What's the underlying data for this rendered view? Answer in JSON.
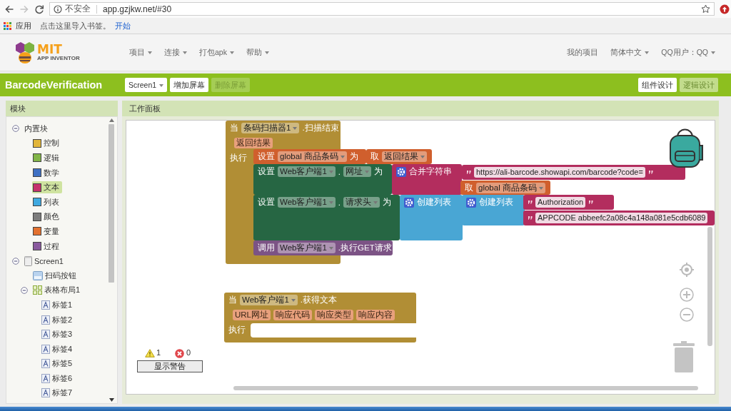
{
  "browser": {
    "security_label": "不安全",
    "url": "app.gzjkw.net/#30"
  },
  "bookmarks_bar": {
    "apps_label": "应用",
    "hint": "点击这里导入书签。",
    "link": "开始"
  },
  "app_header": {
    "logo": {
      "title": "MIT",
      "subtitle": "APP INVENTOR"
    },
    "menu": [
      {
        "label": "项目",
        "dropdown": true
      },
      {
        "label": "连接",
        "dropdown": true
      },
      {
        "label": "打包apk",
        "dropdown": true
      },
      {
        "label": "帮助",
        "dropdown": true
      }
    ],
    "user_menu": [
      {
        "label": "我的项目",
        "dropdown": false
      },
      {
        "label": "简体中文",
        "dropdown": true
      },
      {
        "label": "QQ用户：QQ",
        "dropdown": true
      }
    ]
  },
  "project_bar": {
    "title": "BarcodeVerification",
    "screen_select": "Screen1",
    "screen_buttons": [
      {
        "label": "增加屏幕",
        "disabled": false
      },
      {
        "label": "删除屏幕",
        "disabled": true
      }
    ],
    "view_buttons": [
      {
        "label": "组件设计",
        "selected": false
      },
      {
        "label": "逻辑设计",
        "selected": true
      }
    ]
  },
  "blocks_panel": {
    "title": "模块",
    "tree": [
      {
        "label": "内置块",
        "kind": "folder",
        "expanded": true,
        "selected": false,
        "children": [
          {
            "label": "控制",
            "kind": "category",
            "color": "#e1b53a",
            "selected": false
          },
          {
            "label": "逻辑",
            "kind": "category",
            "color": "#82b548",
            "selected": false
          },
          {
            "label": "数学",
            "kind": "category",
            "color": "#3f71c4",
            "selected": false
          },
          {
            "label": "文本",
            "kind": "category",
            "color": "#c5326c",
            "selected": true
          },
          {
            "label": "列表",
            "kind": "category",
            "color": "#3fa9e0",
            "selected": false
          },
          {
            "label": "颜色",
            "kind": "category",
            "color": "#7d7d7d",
            "selected": false
          },
          {
            "label": "变量",
            "kind": "category",
            "color": "#e3712f",
            "selected": false
          },
          {
            "label": "过程",
            "kind": "category",
            "color": "#8a5a9e",
            "selected": false
          }
        ]
      },
      {
        "label": "Screen1",
        "kind": "screen",
        "expanded": true,
        "selected": false,
        "children": [
          {
            "label": "扫码按钮",
            "kind": "button",
            "selected": false
          },
          {
            "label": "表格布局1",
            "kind": "table",
            "expanded": true,
            "selected": false,
            "children": [
              {
                "label": "标签1",
                "kind": "label",
                "selected": false
              },
              {
                "label": "标签2",
                "kind": "label",
                "selected": false
              },
              {
                "label": "标签3",
                "kind": "label",
                "selected": false
              },
              {
                "label": "标签4",
                "kind": "label",
                "selected": false
              },
              {
                "label": "标签5",
                "kind": "label",
                "selected": false
              },
              {
                "label": "标签6",
                "kind": "label",
                "selected": false
              },
              {
                "label": "标签7",
                "kind": "label",
                "selected": false
              }
            ]
          }
        ]
      }
    ]
  },
  "workspace": {
    "title": "工作面板",
    "blocks": [
      {
        "kind": "event",
        "parts": [
          {
            "kind": "label",
            "text": "当"
          },
          {
            "kind": "dropdown",
            "text": "条码扫描器1"
          },
          {
            "kind": "label",
            "text": ".扫描结束"
          }
        ],
        "params": [
          "返回结果"
        ],
        "do_label": "执行"
      },
      {
        "kind": "variable_set",
        "parts": [
          {
            "kind": "label",
            "text": "设置"
          },
          {
            "kind": "dropdown",
            "text": "global 商品条码"
          },
          {
            "kind": "label",
            "text": "为"
          }
        ]
      },
      {
        "kind": "variable_get",
        "parts": [
          {
            "kind": "label",
            "text": "取"
          },
          {
            "kind": "dropdown",
            "text": "返回结果"
          }
        ]
      },
      {
        "kind": "component_set",
        "parts": [
          {
            "kind": "label",
            "text": "设置"
          },
          {
            "kind": "dropdown",
            "text": "Web客户端1"
          },
          {
            "kind": "label",
            "text": "."
          },
          {
            "kind": "dropdown",
            "text": "网址"
          },
          {
            "kind": "label",
            "text": "为"
          }
        ]
      },
      {
        "kind": "text_join",
        "parts": [
          {
            "kind": "label",
            "text": "合并字符串"
          }
        ]
      },
      {
        "kind": "text",
        "parts": [
          {
            "kind": "string",
            "text": "https://ali-barcode.showapi.com/barcode?code="
          }
        ]
      },
      {
        "kind": "variable_get",
        "parts": [
          {
            "kind": "label",
            "text": "取"
          },
          {
            "kind": "dropdown",
            "text": "global 商品条码"
          }
        ]
      },
      {
        "kind": "component_set",
        "parts": [
          {
            "kind": "label",
            "text": "设置"
          },
          {
            "kind": "dropdown",
            "text": "Web客户端1"
          },
          {
            "kind": "label",
            "text": "."
          },
          {
            "kind": "dropdown",
            "text": "请求头"
          },
          {
            "kind": "label",
            "text": "为"
          }
        ]
      },
      {
        "kind": "list_create",
        "parts": [
          {
            "kind": "label",
            "text": "创建列表"
          }
        ]
      },
      {
        "kind": "list_create",
        "parts": [
          {
            "kind": "label",
            "text": "创建列表"
          }
        ]
      },
      {
        "kind": "text",
        "parts": [
          {
            "kind": "string",
            "text": "Authorization"
          }
        ]
      },
      {
        "kind": "text",
        "parts": [
          {
            "kind": "string",
            "text": "APPCODE abbeefc2a08c4a148a081e5cdb6089"
          }
        ]
      },
      {
        "kind": "method_call",
        "parts": [
          {
            "kind": "label",
            "text": "调用"
          },
          {
            "kind": "dropdown",
            "text": "Web客户端1"
          },
          {
            "kind": "label",
            "text": ".执行GET请求"
          }
        ]
      },
      {
        "kind": "event",
        "parts": [
          {
            "kind": "label",
            "text": "当"
          },
          {
            "kind": "dropdown",
            "text": "Web客户端1"
          },
          {
            "kind": "label",
            "text": ".获得文本"
          }
        ],
        "params": [
          "URL网址",
          "响应代码",
          "响应类型",
          "响应内容"
        ],
        "do_label": "执行"
      }
    ],
    "warning_count": "1",
    "error_count": "0",
    "warnings_button": "显示警告"
  }
}
